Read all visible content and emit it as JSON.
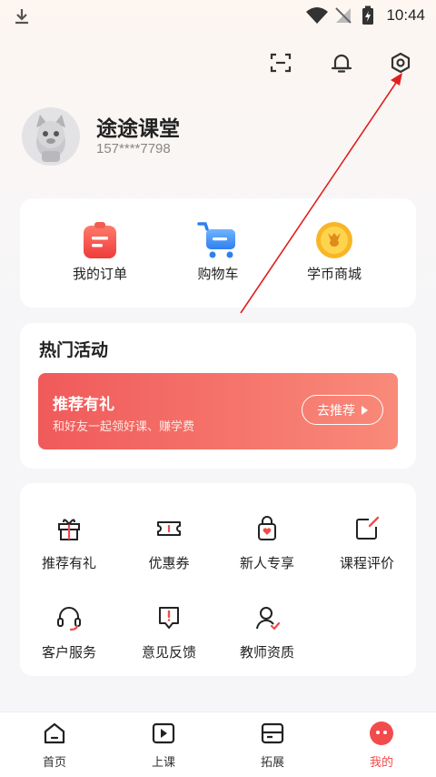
{
  "status_bar": {
    "time": "10:44"
  },
  "user": {
    "name": "途途课堂",
    "phone": "157****7798"
  },
  "quick_links": [
    {
      "label": "我的订单",
      "icon": "order-icon"
    },
    {
      "label": "购物车",
      "icon": "cart-icon"
    },
    {
      "label": "学币商城",
      "icon": "coin-mall-icon"
    }
  ],
  "activities": {
    "title": "热门活动",
    "banner": {
      "title": "推荐有礼",
      "subtitle": "和好友一起领好课、赚学费",
      "button": "去推荐"
    }
  },
  "services": [
    {
      "label": "推荐有礼",
      "icon": "gift-icon"
    },
    {
      "label": "优惠券",
      "icon": "coupon-icon"
    },
    {
      "label": "新人专享",
      "icon": "newcomer-bag-icon"
    },
    {
      "label": "课程评价",
      "icon": "review-edit-icon"
    },
    {
      "label": "客户服务",
      "icon": "headset-icon"
    },
    {
      "label": "意见反馈",
      "icon": "feedback-icon"
    },
    {
      "label": "教师资质",
      "icon": "teacher-icon"
    }
  ],
  "tabbar": [
    {
      "label": "首页",
      "icon": "home-icon"
    },
    {
      "label": "上课",
      "icon": "play-icon"
    },
    {
      "label": "拓展",
      "icon": "expand-icon"
    },
    {
      "label": "我的",
      "icon": "profile-icon",
      "active": true
    }
  ],
  "colors": {
    "accent": "#f24b4b",
    "banner_start": "#f05a5a",
    "banner_end": "#f98a7a",
    "page_bg": "#f6f6f8"
  }
}
